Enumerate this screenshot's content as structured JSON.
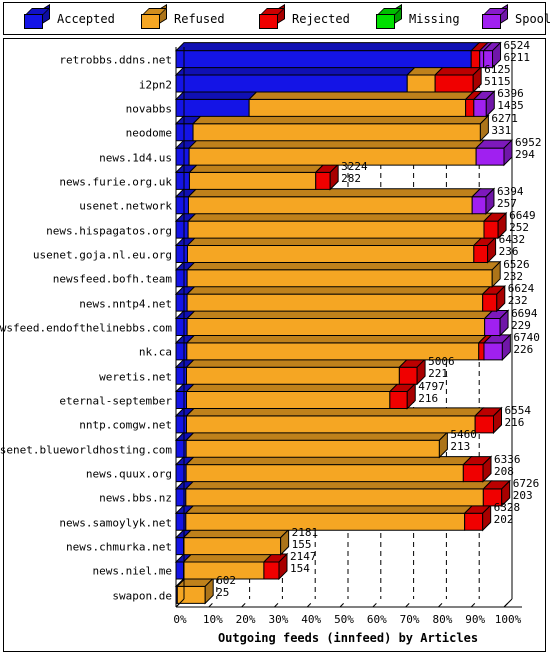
{
  "legend": {
    "items": [
      {
        "label": "Accepted",
        "color": "#1414e6",
        "icon": "cube-icon"
      },
      {
        "label": "Refused",
        "color": "#f5a623",
        "icon": "cube-icon"
      },
      {
        "label": "Rejected",
        "color": "#f00000",
        "icon": "cube-icon"
      },
      {
        "label": "Missing",
        "color": "#00e000",
        "icon": "cube-icon"
      },
      {
        "label": "Spooled",
        "color": "#a020f0",
        "icon": "cube-icon"
      }
    ]
  },
  "chart_data": {
    "type": "bar",
    "orientation": "horizontal",
    "stacked": true,
    "percent_of_total": true,
    "title": "Outgoing feeds (innfeed) by Articles",
    "xlabel": "Outgoing feeds (innfeed) by Articles",
    "ylabel": "",
    "xlim": [
      0,
      100
    ],
    "xticks": [
      "0%",
      "10%",
      "20%",
      "30%",
      "40%",
      "50%",
      "60%",
      "70%",
      "80%",
      "90%",
      "100%"
    ],
    "xtick_values": [
      0,
      10,
      20,
      30,
      40,
      50,
      60,
      70,
      80,
      90,
      100
    ],
    "grid": true,
    "legend_position": "top",
    "series": [
      {
        "name": "Accepted",
        "color": "#1414e6"
      },
      {
        "name": "Refused",
        "color": "#f5a623"
      },
      {
        "name": "Rejected",
        "color": "#f00000"
      },
      {
        "name": "Missing",
        "color": "#00e000"
      },
      {
        "name": "Spooled",
        "color": "#a020f0"
      }
    ],
    "categories": [
      "retrobbs.ddns.net",
      "i2pn2",
      "novabbs",
      "neodome",
      "news.1d4.us",
      "news.furie.org.uk",
      "usenet.network",
      "news.hispagatos.org",
      "usenet.goja.nl.eu.org",
      "newsfeed.bofh.team",
      "news.nntp4.net",
      "newsfeed.endofthelinebbs.com",
      "nk.ca",
      "weretis.net",
      "eternal-september",
      "nntp.comgw.net",
      "usenet.blueworldhosting.com",
      "news.quux.org",
      "news.bbs.nz",
      "news.samoylyk.net",
      "news.chmurka.net",
      "news.niel.me",
      "swapon.de"
    ],
    "rows": [
      {
        "label": "retrobbs.ddns.net",
        "top": 6524,
        "bottom": 6211,
        "bar_pct": 96.5,
        "segments": [
          {
            "name": "Accepted",
            "pct": 90.0
          },
          {
            "name": "Rejected",
            "pct": 2.6
          },
          {
            "name": "Spooled",
            "pct": 1.2
          },
          {
            "name": "Spooled",
            "pct": 2.7
          }
        ]
      },
      {
        "label": "i2pn2",
        "top": 6125,
        "bottom": 5115,
        "bar_pct": 90.6,
        "segments": [
          {
            "name": "Accepted",
            "pct": 70.5
          },
          {
            "name": "Refused",
            "pct": 8.5
          },
          {
            "name": "Rejected",
            "pct": 11.6
          }
        ]
      },
      {
        "label": "novabbs",
        "top": 6396,
        "bottom": 1435,
        "bar_pct": 94.6,
        "segments": [
          {
            "name": "Accepted",
            "pct": 22.3
          },
          {
            "name": "Refused",
            "pct": 66.0
          },
          {
            "name": "Rejected",
            "pct": 2.5
          },
          {
            "name": "Spooled",
            "pct": 3.8
          }
        ]
      },
      {
        "label": "neodome",
        "top": 6271,
        "bottom": 331,
        "bar_pct": 92.8,
        "segments": [
          {
            "name": "Accepted",
            "pct": 5.2
          },
          {
            "name": "Refused",
            "pct": 87.6
          }
        ]
      },
      {
        "label": "news.1d4.us",
        "top": 6952,
        "bottom": 294,
        "bar_pct": 100.0,
        "segments": [
          {
            "name": "Accepted",
            "pct": 4.0
          },
          {
            "name": "Refused",
            "pct": 87.5
          },
          {
            "name": "Spooled",
            "pct": 8.5
          }
        ]
      },
      {
        "label": "news.furie.org.uk",
        "top": 3224,
        "bottom": 282,
        "bar_pct": 47.0,
        "segments": [
          {
            "name": "Accepted",
            "pct": 4.1
          },
          {
            "name": "Refused",
            "pct": 38.5
          },
          {
            "name": "Rejected",
            "pct": 4.4
          }
        ]
      },
      {
        "label": "usenet.network",
        "top": 6394,
        "bottom": 257,
        "bar_pct": 94.5,
        "segments": [
          {
            "name": "Accepted",
            "pct": 3.8
          },
          {
            "name": "Refused",
            "pct": 86.5
          },
          {
            "name": "Spooled",
            "pct": 4.2
          }
        ]
      },
      {
        "label": "news.hispagatos.org",
        "top": 6649,
        "bottom": 252,
        "bar_pct": 98.2,
        "segments": [
          {
            "name": "Accepted",
            "pct": 3.7
          },
          {
            "name": "Refused",
            "pct": 90.2
          },
          {
            "name": "Rejected",
            "pct": 4.3
          }
        ]
      },
      {
        "label": "usenet.goja.nl.eu.org",
        "top": 6432,
        "bottom": 236,
        "bar_pct": 95.0,
        "segments": [
          {
            "name": "Accepted",
            "pct": 3.5
          },
          {
            "name": "Refused",
            "pct": 87.3
          },
          {
            "name": "Rejected",
            "pct": 4.2
          }
        ]
      },
      {
        "label": "newsfeed.bofh.team",
        "top": 6526,
        "bottom": 232,
        "bar_pct": 96.4,
        "segments": [
          {
            "name": "Accepted",
            "pct": 3.4
          },
          {
            "name": "Refused",
            "pct": 93.0
          }
        ]
      },
      {
        "label": "news.nntp4.net",
        "top": 6624,
        "bottom": 232,
        "bar_pct": 97.8,
        "segments": [
          {
            "name": "Accepted",
            "pct": 3.4
          },
          {
            "name": "Refused",
            "pct": 90.1
          },
          {
            "name": "Rejected",
            "pct": 4.3
          }
        ]
      },
      {
        "label": "newsfeed.endofthelinebbs.com",
        "top": 6694,
        "bottom": 229,
        "bar_pct": 98.8,
        "segments": [
          {
            "name": "Accepted",
            "pct": 3.4
          },
          {
            "name": "Refused",
            "pct": 90.7
          },
          {
            "name": "Spooled",
            "pct": 4.7
          }
        ]
      },
      {
        "label": "nk.ca",
        "top": 6740,
        "bottom": 226,
        "bar_pct": 99.5,
        "segments": [
          {
            "name": "Accepted",
            "pct": 3.3
          },
          {
            "name": "Refused",
            "pct": 89.0
          },
          {
            "name": "Rejected",
            "pct": 1.6
          },
          {
            "name": "Spooled",
            "pct": 5.6
          }
        ]
      },
      {
        "label": "weretis.net",
        "top": 5006,
        "bottom": 221,
        "bar_pct": 73.5,
        "segments": [
          {
            "name": "Accepted",
            "pct": 3.2
          },
          {
            "name": "Refused",
            "pct": 64.9
          },
          {
            "name": "Rejected",
            "pct": 5.4
          }
        ]
      },
      {
        "label": "eternal-september",
        "top": 4797,
        "bottom": 216,
        "bar_pct": 70.5,
        "segments": [
          {
            "name": "Accepted",
            "pct": 3.2
          },
          {
            "name": "Refused",
            "pct": 62.0
          },
          {
            "name": "Rejected",
            "pct": 5.3
          }
        ]
      },
      {
        "label": "nntp.comgw.net",
        "top": 6554,
        "bottom": 216,
        "bar_pct": 96.8,
        "segments": [
          {
            "name": "Accepted",
            "pct": 3.2
          },
          {
            "name": "Refused",
            "pct": 88.0
          },
          {
            "name": "Rejected",
            "pct": 5.6
          }
        ]
      },
      {
        "label": "usenet.blueworldhosting.com",
        "top": 5460,
        "bottom": 213,
        "bar_pct": 80.3,
        "segments": [
          {
            "name": "Accepted",
            "pct": 3.1
          },
          {
            "name": "Refused",
            "pct": 77.2
          }
        ]
      },
      {
        "label": "news.quux.org",
        "top": 6336,
        "bottom": 208,
        "bar_pct": 93.6,
        "segments": [
          {
            "name": "Accepted",
            "pct": 3.1
          },
          {
            "name": "Refused",
            "pct": 84.5
          },
          {
            "name": "Rejected",
            "pct": 6.0
          }
        ]
      },
      {
        "label": "news.bbs.nz",
        "top": 6726,
        "bottom": 203,
        "bar_pct": 99.3,
        "segments": [
          {
            "name": "Accepted",
            "pct": 3.0
          },
          {
            "name": "Refused",
            "pct": 90.7
          },
          {
            "name": "Rejected",
            "pct": 5.6
          }
        ]
      },
      {
        "label": "news.samoylyk.net",
        "top": 6328,
        "bottom": 202,
        "bar_pct": 93.5,
        "segments": [
          {
            "name": "Accepted",
            "pct": 3.0
          },
          {
            "name": "Refused",
            "pct": 85.0
          },
          {
            "name": "Rejected",
            "pct": 5.5
          }
        ]
      },
      {
        "label": "news.chmurka.net",
        "top": 2181,
        "bottom": 155,
        "bar_pct": 31.9,
        "segments": [
          {
            "name": "Accepted",
            "pct": 2.3
          },
          {
            "name": "Refused",
            "pct": 29.6
          }
        ]
      },
      {
        "label": "news.niel.me",
        "top": 2147,
        "bottom": 154,
        "bar_pct": 31.4,
        "segments": [
          {
            "name": "Accepted",
            "pct": 2.3
          },
          {
            "name": "Refused",
            "pct": 24.5
          },
          {
            "name": "Rejected",
            "pct": 4.6
          }
        ]
      },
      {
        "label": "swapon.de",
        "top": 602,
        "bottom": 25,
        "bar_pct": 8.9,
        "segments": [
          {
            "name": "Accepted",
            "pct": 0.4
          },
          {
            "name": "Refused",
            "pct": 8.5
          }
        ]
      }
    ]
  }
}
